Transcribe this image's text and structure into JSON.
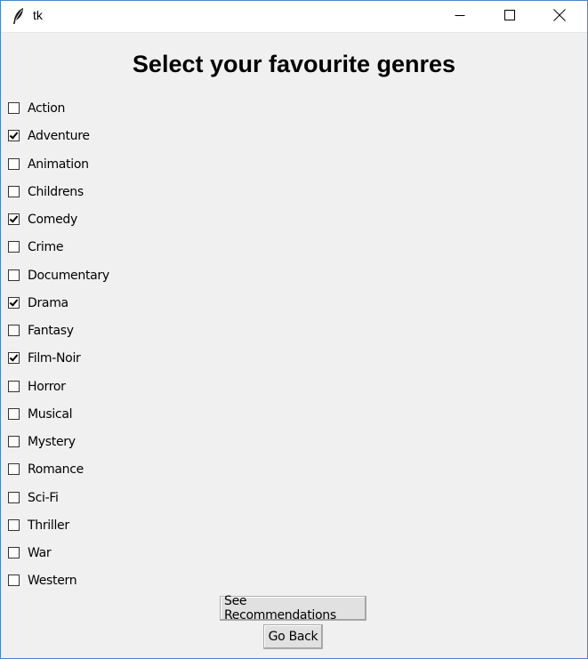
{
  "window": {
    "title": "tk",
    "controls": [
      "minimize-icon",
      "maximize-icon",
      "close-icon"
    ]
  },
  "heading": "Select your favourite genres",
  "genres": [
    {
      "label": "Action",
      "checked": false
    },
    {
      "label": "Adventure",
      "checked": true
    },
    {
      "label": "Animation",
      "checked": false
    },
    {
      "label": "Childrens",
      "checked": false
    },
    {
      "label": "Comedy",
      "checked": true
    },
    {
      "label": "Crime",
      "checked": false
    },
    {
      "label": "Documentary",
      "checked": false
    },
    {
      "label": "Drama",
      "checked": true
    },
    {
      "label": "Fantasy",
      "checked": false
    },
    {
      "label": "Film-Noir",
      "checked": true
    },
    {
      "label": "Horror",
      "checked": false
    },
    {
      "label": "Musical",
      "checked": false
    },
    {
      "label": "Mystery",
      "checked": false
    },
    {
      "label": "Romance",
      "checked": false
    },
    {
      "label": "Sci-Fi",
      "checked": false
    },
    {
      "label": "Thriller",
      "checked": false
    },
    {
      "label": "War",
      "checked": false
    },
    {
      "label": "Western",
      "checked": false
    }
  ],
  "buttons": {
    "see_recommendations": "See Recommendations",
    "go_back": "Go Back"
  }
}
